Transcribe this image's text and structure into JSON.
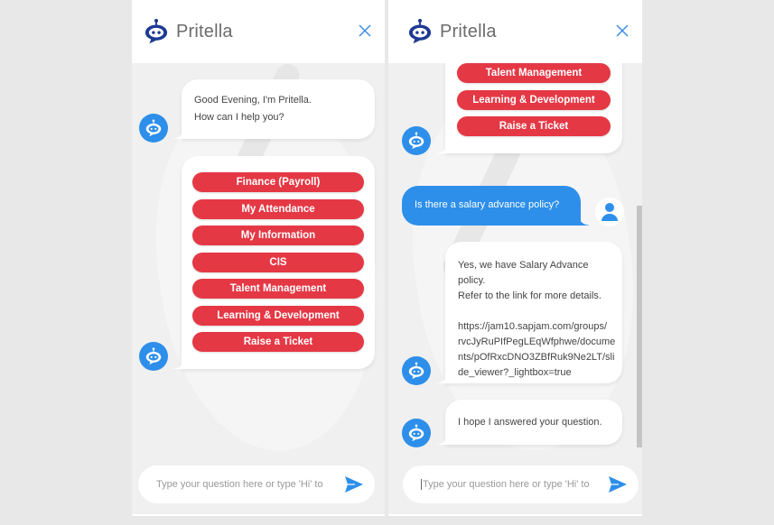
{
  "app": {
    "title": "Pritella",
    "brand_color": "#1f3a93",
    "accent_blue": "#2d8fea",
    "option_red": "#e53845"
  },
  "left_panel": {
    "header": {
      "title": "Pritella",
      "close_icon": "close-icon"
    },
    "greeting": {
      "line1": "Good Evening, I'm Pritella.",
      "line2": "How can I help you?"
    },
    "options": [
      {
        "label": "Finance (Payroll)"
      },
      {
        "label": "My Attendance"
      },
      {
        "label": "My Information"
      },
      {
        "label": "CIS"
      },
      {
        "label": "Talent Management"
      },
      {
        "label": "Learning & Development"
      },
      {
        "label": "Raise a Ticket"
      }
    ],
    "input": {
      "placeholder": "Type your question here or type 'Hi' to",
      "value": ""
    }
  },
  "right_panel": {
    "header": {
      "title": "Pritella",
      "close_icon": "close-icon"
    },
    "options_visible": [
      {
        "label": "Talent Management"
      },
      {
        "label": "Learning & Development"
      },
      {
        "label": "Raise a Ticket"
      }
    ],
    "user_message": "Is there a salary advance policy?",
    "bot_reply": {
      "line1": "Yes, we have Salary Advance policy.",
      "line2": "Refer to the link for more details.",
      "link_lines": [
        "https://jam10.sapjam.com/groups/",
        "rvcJyRuPIfPegLEqWfphwe/docume",
        "nts/pOfRxcDNO3ZBfRuk9Ne2LT/sli",
        "de_viewer?_lightbox=true"
      ]
    },
    "closing_message": "I hope I answered your question.",
    "input": {
      "placeholder": "Type your question here or type 'Hi' to",
      "value": ""
    }
  }
}
